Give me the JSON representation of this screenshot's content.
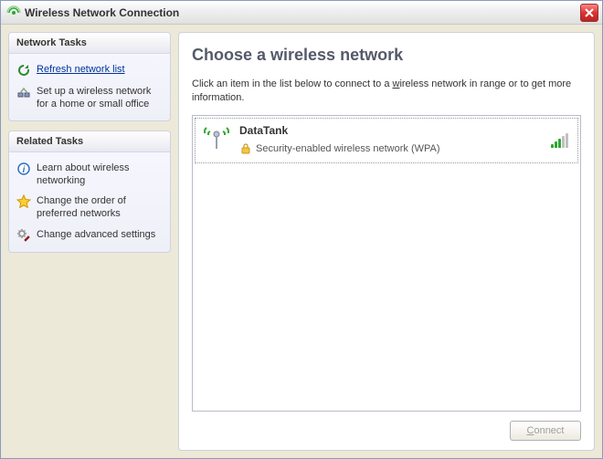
{
  "window": {
    "title": "Wireless Network Connection"
  },
  "sidebar": {
    "network_tasks": {
      "header": "Network Tasks",
      "refresh": "Refresh network list",
      "setup": "Set up a wireless network for a home or small office"
    },
    "related_tasks": {
      "header": "Related Tasks",
      "learn": "Learn about wireless networking",
      "order": "Change the order of preferred networks",
      "advanced": "Change advanced settings"
    }
  },
  "main": {
    "title": "Choose a wireless network",
    "instructions_pre": "Click an item in the list below to connect to a ",
    "instructions_underlined": "w",
    "instructions_post": "ireless network in range or to get more information."
  },
  "networks": [
    {
      "name": "DataTank",
      "security": "Security-enabled wireless network (WPA)",
      "signal_bars": 3
    }
  ],
  "footer": {
    "connect_label": "Connect",
    "connect_accesskey": "C",
    "connect_enabled": false
  }
}
